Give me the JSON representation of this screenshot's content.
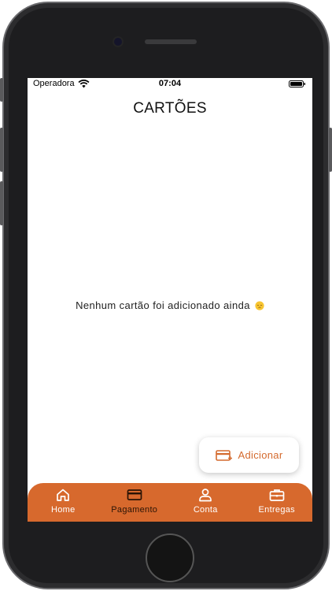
{
  "status_bar": {
    "carrier": "Operadora",
    "time": "07:04"
  },
  "header": {
    "title": "CARTÕES"
  },
  "content": {
    "empty_message": "Nenhum cartão foi adicionado ainda"
  },
  "fab": {
    "label": "Adicionar",
    "icon": "add-card-icon"
  },
  "bottom_nav": {
    "active_index": 1,
    "items": [
      {
        "label": "Home",
        "icon": "home-icon"
      },
      {
        "label": "Pagamento",
        "icon": "credit-card-icon"
      },
      {
        "label": "Conta",
        "icon": "user-icon"
      },
      {
        "label": "Entregas",
        "icon": "briefcase-icon"
      }
    ]
  },
  "colors": {
    "accent": "#d7692d",
    "active_nav_text": "#2a1406"
  }
}
